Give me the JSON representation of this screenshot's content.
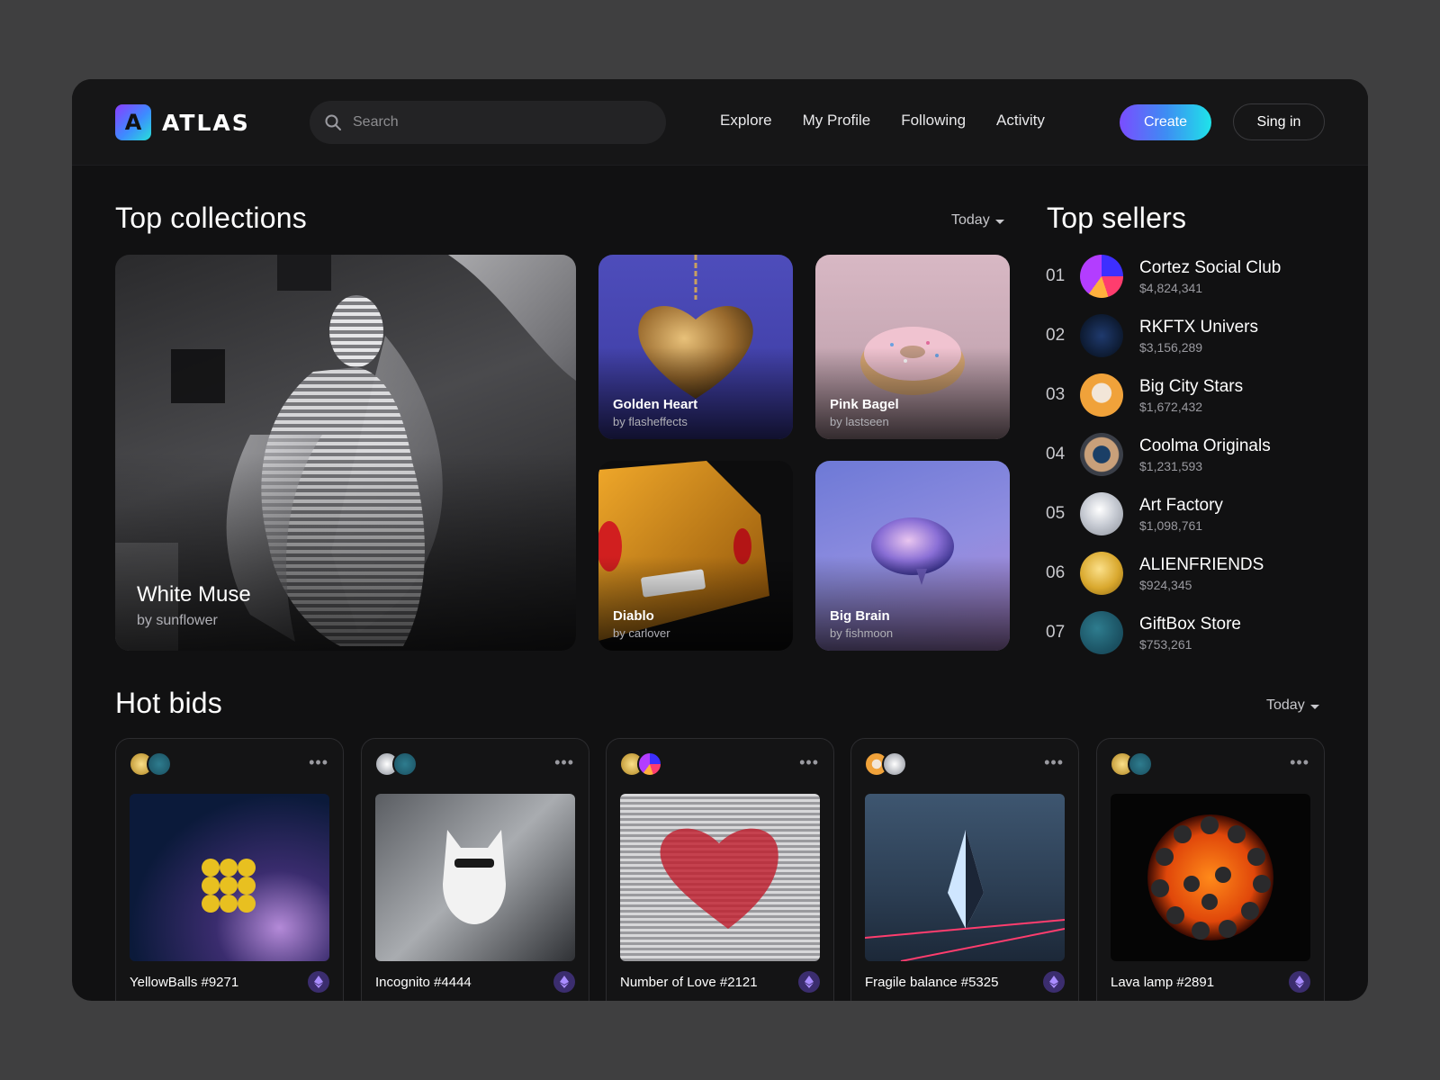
{
  "app": {
    "name": "ATLAS",
    "logo_letter": "A"
  },
  "search": {
    "placeholder": "Search"
  },
  "nav": [
    {
      "label": "Explore"
    },
    {
      "label": "My Profile"
    },
    {
      "label": "Following"
    },
    {
      "label": "Activity"
    }
  ],
  "actions": {
    "create": "Create",
    "signin": "Sing in"
  },
  "top_collections": {
    "title": "Top collections",
    "filter": "Today",
    "items": [
      {
        "title": "White Muse",
        "author": "by sunflower"
      },
      {
        "title": "Golden Heart",
        "author": "by flasheffects"
      },
      {
        "title": "Pink Bagel",
        "author": "by lastseen"
      },
      {
        "title": "Diablo",
        "author": "by carlover"
      },
      {
        "title": "Big Brain",
        "author": "by fishmoon"
      }
    ]
  },
  "top_sellers": {
    "title": "Top sellers",
    "items": [
      {
        "rank": "01",
        "name": "Cortez Social Club",
        "amount": "$4,824,341"
      },
      {
        "rank": "02",
        "name": "RKFTX Univers",
        "amount": "$3,156,289"
      },
      {
        "rank": "03",
        "name": "Big City Stars",
        "amount": "$1,672,432"
      },
      {
        "rank": "04",
        "name": "Coolma Originals",
        "amount": "$1,231,593"
      },
      {
        "rank": "05",
        "name": "Art Factory",
        "amount": "$1,098,761"
      },
      {
        "rank": "06",
        "name": "ALIENFRIENDS",
        "amount": "$924,345"
      },
      {
        "rank": "07",
        "name": "GiftBox Store",
        "amount": "$753,261"
      }
    ]
  },
  "hot_bids": {
    "title": "Hot bids",
    "filter": "Today",
    "items": [
      {
        "name": "YellowBalls #9271"
      },
      {
        "name": "Incognito #4444"
      },
      {
        "name": "Number of Love #2121"
      },
      {
        "name": "Fragile balance #5325"
      },
      {
        "name": "Lava lamp #2891"
      }
    ]
  },
  "colors": {
    "background": "#3f3f40",
    "panel": "#111112",
    "accent_start": "#7a4dff",
    "accent_end": "#1fe3e9"
  },
  "icons": [
    "search-icon",
    "chevron-down-icon",
    "more-icon",
    "ethereum-icon"
  ]
}
